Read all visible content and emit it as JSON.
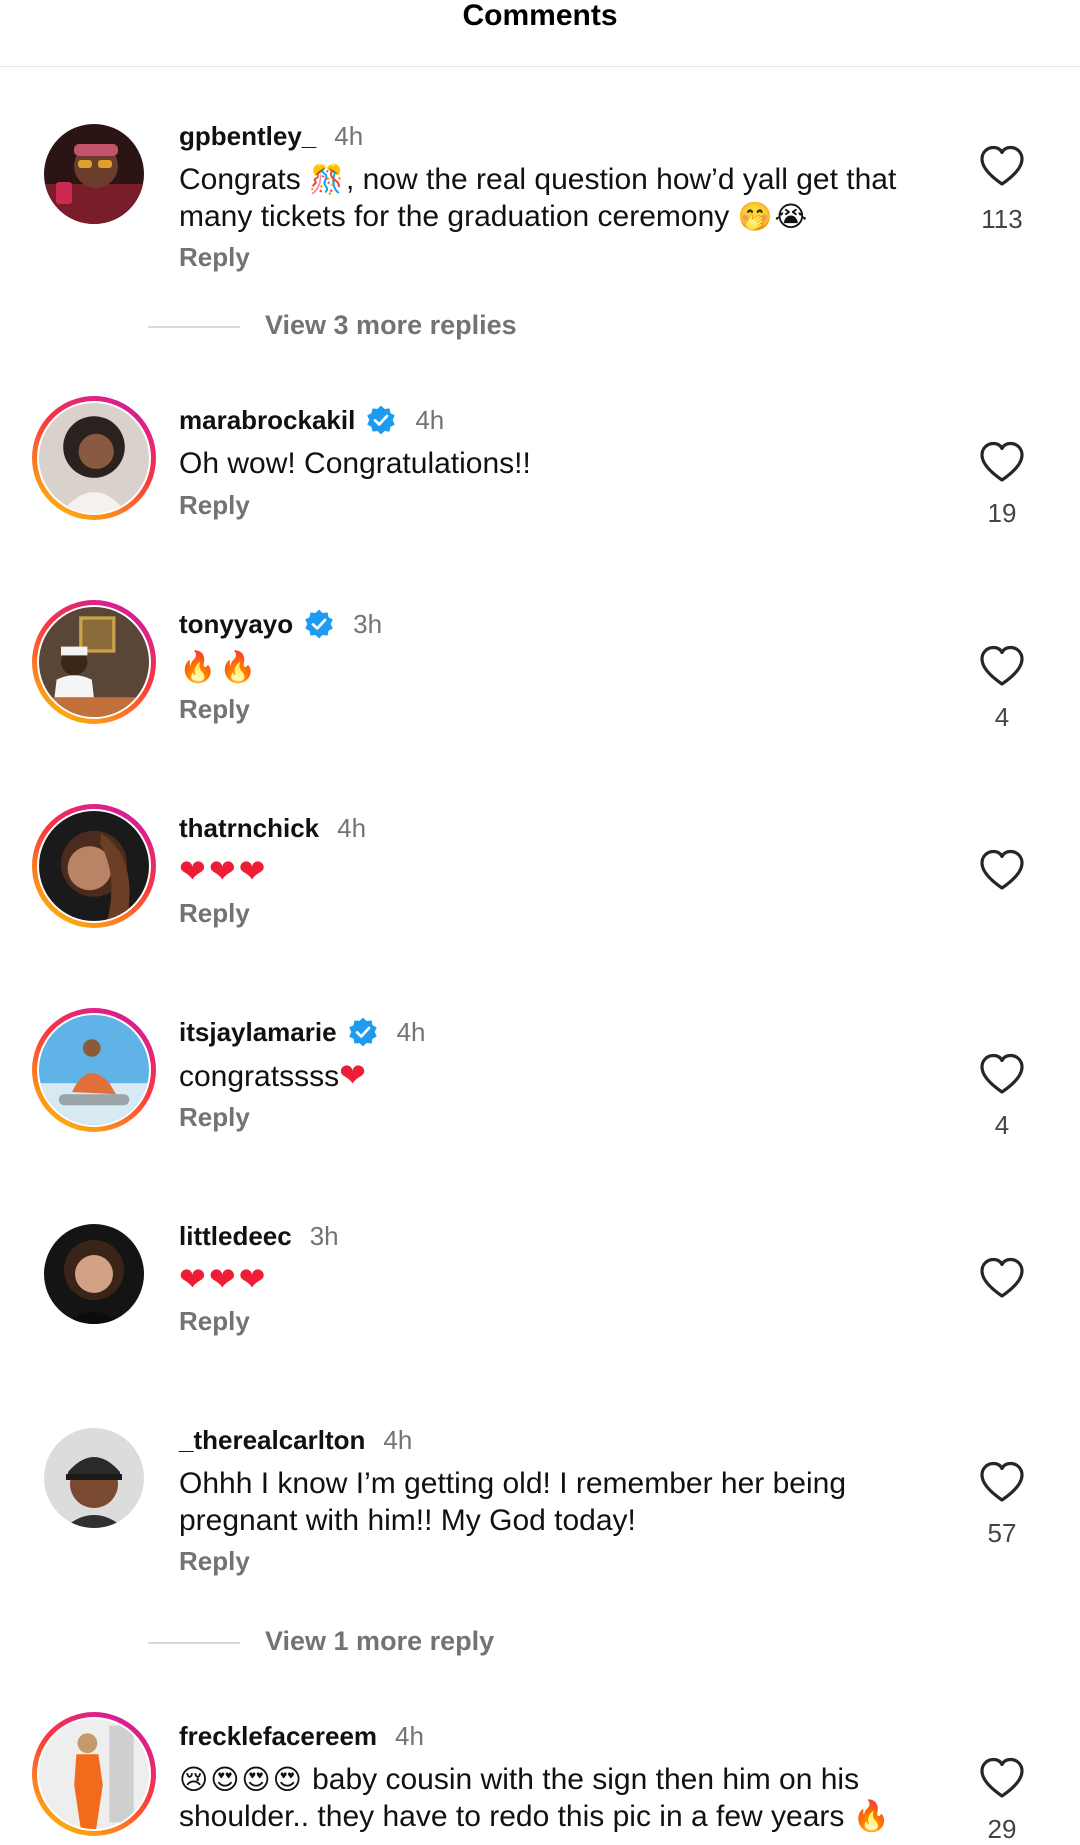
{
  "header": {
    "title": "Comments"
  },
  "actions": {
    "reply_label": "Reply"
  },
  "comments": [
    {
      "username": "gpbentley_",
      "time": "4h",
      "text_line1": "Congrats ",
      "emoji1": "🎊",
      "text_line1b": ", now the real question how’d yall get that",
      "text_line2": "many tickets for the graduation ceremony ",
      "emoji2": "🤭😭",
      "likes": "113",
      "view_more": "View 3 more replies"
    },
    {
      "username": "marabrockakil",
      "time": "4h",
      "text": "Oh wow!  Congratulations!!",
      "likes": "19"
    },
    {
      "username": "tonyyayo",
      "time": "3h",
      "emoji": "🔥🔥",
      "likes": "4"
    },
    {
      "username": "thatrnchick",
      "time": "4h",
      "emoji": "❤❤❤"
    },
    {
      "username": "itsjaylamarie",
      "time": "4h",
      "text": "congratssss",
      "emoji": "❤",
      "likes": "4"
    },
    {
      "username": "littledeec",
      "time": "3h",
      "emoji": "❤❤❤"
    },
    {
      "username": "_therealcarlton",
      "time": "4h",
      "text_line1": "Ohhh I know I’m getting old! I remember her being",
      "text_line2": "pregnant with him!! My God today!",
      "likes": "57",
      "view_more": "View 1 more reply"
    },
    {
      "username": "frecklefacereem",
      "time": "4h",
      "emoji": "😢😍😍😍",
      "text_line1": " baby cousin with the sign then him on his",
      "text_line2": "shoulder.. they have to redo this pic in a few years ",
      "emoji2": "🔥",
      "likes": "29"
    }
  ],
  "colors": {
    "verified": "#1d9bf0",
    "muted": "#737373",
    "heart": "#ee1d36"
  }
}
